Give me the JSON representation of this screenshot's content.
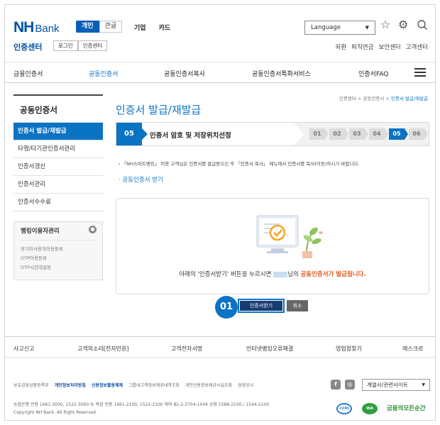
{
  "brand": {
    "logo_nh": "NH",
    "logo_bank": "Bank",
    "sub_title": "인증센터"
  },
  "segments": [
    {
      "label": "개인"
    },
    {
      "label": "큰글"
    }
  ],
  "top_nav": [
    {
      "label": "기업"
    },
    {
      "label": "카드"
    }
  ],
  "language": {
    "label": "Language"
  },
  "cert_buttons": [
    {
      "label": "로그인"
    },
    {
      "label": "인증센터"
    }
  ],
  "utility": [
    {
      "label": "외환"
    },
    {
      "label": "퇴직연금"
    },
    {
      "label": "보안센터"
    },
    {
      "label": "고객센터"
    }
  ],
  "gnb": [
    {
      "label": "금융인증서"
    },
    {
      "label": "공동인증서"
    },
    {
      "label": "공동인증서복사"
    },
    {
      "label": "공동인증서특화서비스"
    },
    {
      "label": "인증서FAQ"
    }
  ],
  "sidebar": {
    "title": "공동인증서",
    "items": [
      {
        "label": "인증서 발급/재발급"
      },
      {
        "label": "타행/타기관인증서관리"
      },
      {
        "label": "인증서갱신"
      },
      {
        "label": "인증서관리"
      },
      {
        "label": "인증서수수료"
      }
    ],
    "banking": {
      "title": "뱅킹이용자관리",
      "links": [
        {
          "label": "장기미사용자이용등록"
        },
        {
          "label": "OTP이용등록"
        },
        {
          "label": "OTP시간대설정"
        }
      ]
    }
  },
  "breadcrumb": {
    "home": "인증센터",
    "sep1": ">",
    "mid": "공동인증서",
    "sep2": ">",
    "current": "인증서 발급/재발급"
  },
  "page_title": "인증서 발급/재발급",
  "step": {
    "current_number": "05",
    "current_label": "인증서 암호 및 저장위치선정",
    "chips": [
      {
        "label": "01"
      },
      {
        "label": "02"
      },
      {
        "label": "03"
      },
      {
        "label": "04"
      },
      {
        "label": "05"
      },
      {
        "label": "06"
      }
    ],
    "active_index": 4
  },
  "notice": "「NH스마트뱅킹」 이용 고객님은 인증서를 발급받으신 후 「인증서 복사」 메뉴에서 인증서를 복사(이동)하시기 바랍니다.",
  "section_link": "공동인증서 받기",
  "message": {
    "before": "아래의 '인증서받기' 버튼을 누르시면",
    "after": "님의",
    "highlight": "공동인증서가 발급됩니다."
  },
  "marker": "01",
  "buttons": {
    "issue": "인증서받기",
    "cancel": "취소"
  },
  "footer_links": [
    {
      "label": "사고신고"
    },
    {
      "label": "고객의소리[전자민원]"
    },
    {
      "label": "고객전자서명"
    },
    {
      "label": "인터넷뱅킹오류해결"
    },
    {
      "label": "영업점찾기"
    },
    {
      "label": "에스크로"
    }
  ],
  "policy_links": [
    {
      "label": "보호금융상품등록부"
    },
    {
      "label": "개인정보처리방침"
    },
    {
      "label": "신용정보활용체제"
    },
    {
      "label": "그룹내고객정보제공내역조회"
    },
    {
      "label": "개인신용정보제공사실조회"
    },
    {
      "label": "경영공시"
    }
  ],
  "contact": {
    "line1": "농협은행 전용 1661-3000, 1522-3000  농 축협 전용 1661-2100, 1522-2100  해외 82-2-3704-1004  공용 1588-2100 / 1544-2100",
    "line2": "Copyright NH Bank. All Right Reserved."
  },
  "family_site": {
    "label": "계열사/관련사이트"
  },
  "cert_marks": {
    "ccm": "ccm",
    "wa": "WA",
    "slogan": "금융의모든순간"
  },
  "colors": {
    "brand_blue": "#0052a4",
    "accent_blue": "#0b73c4",
    "highlight_orange": "#e2571e"
  }
}
